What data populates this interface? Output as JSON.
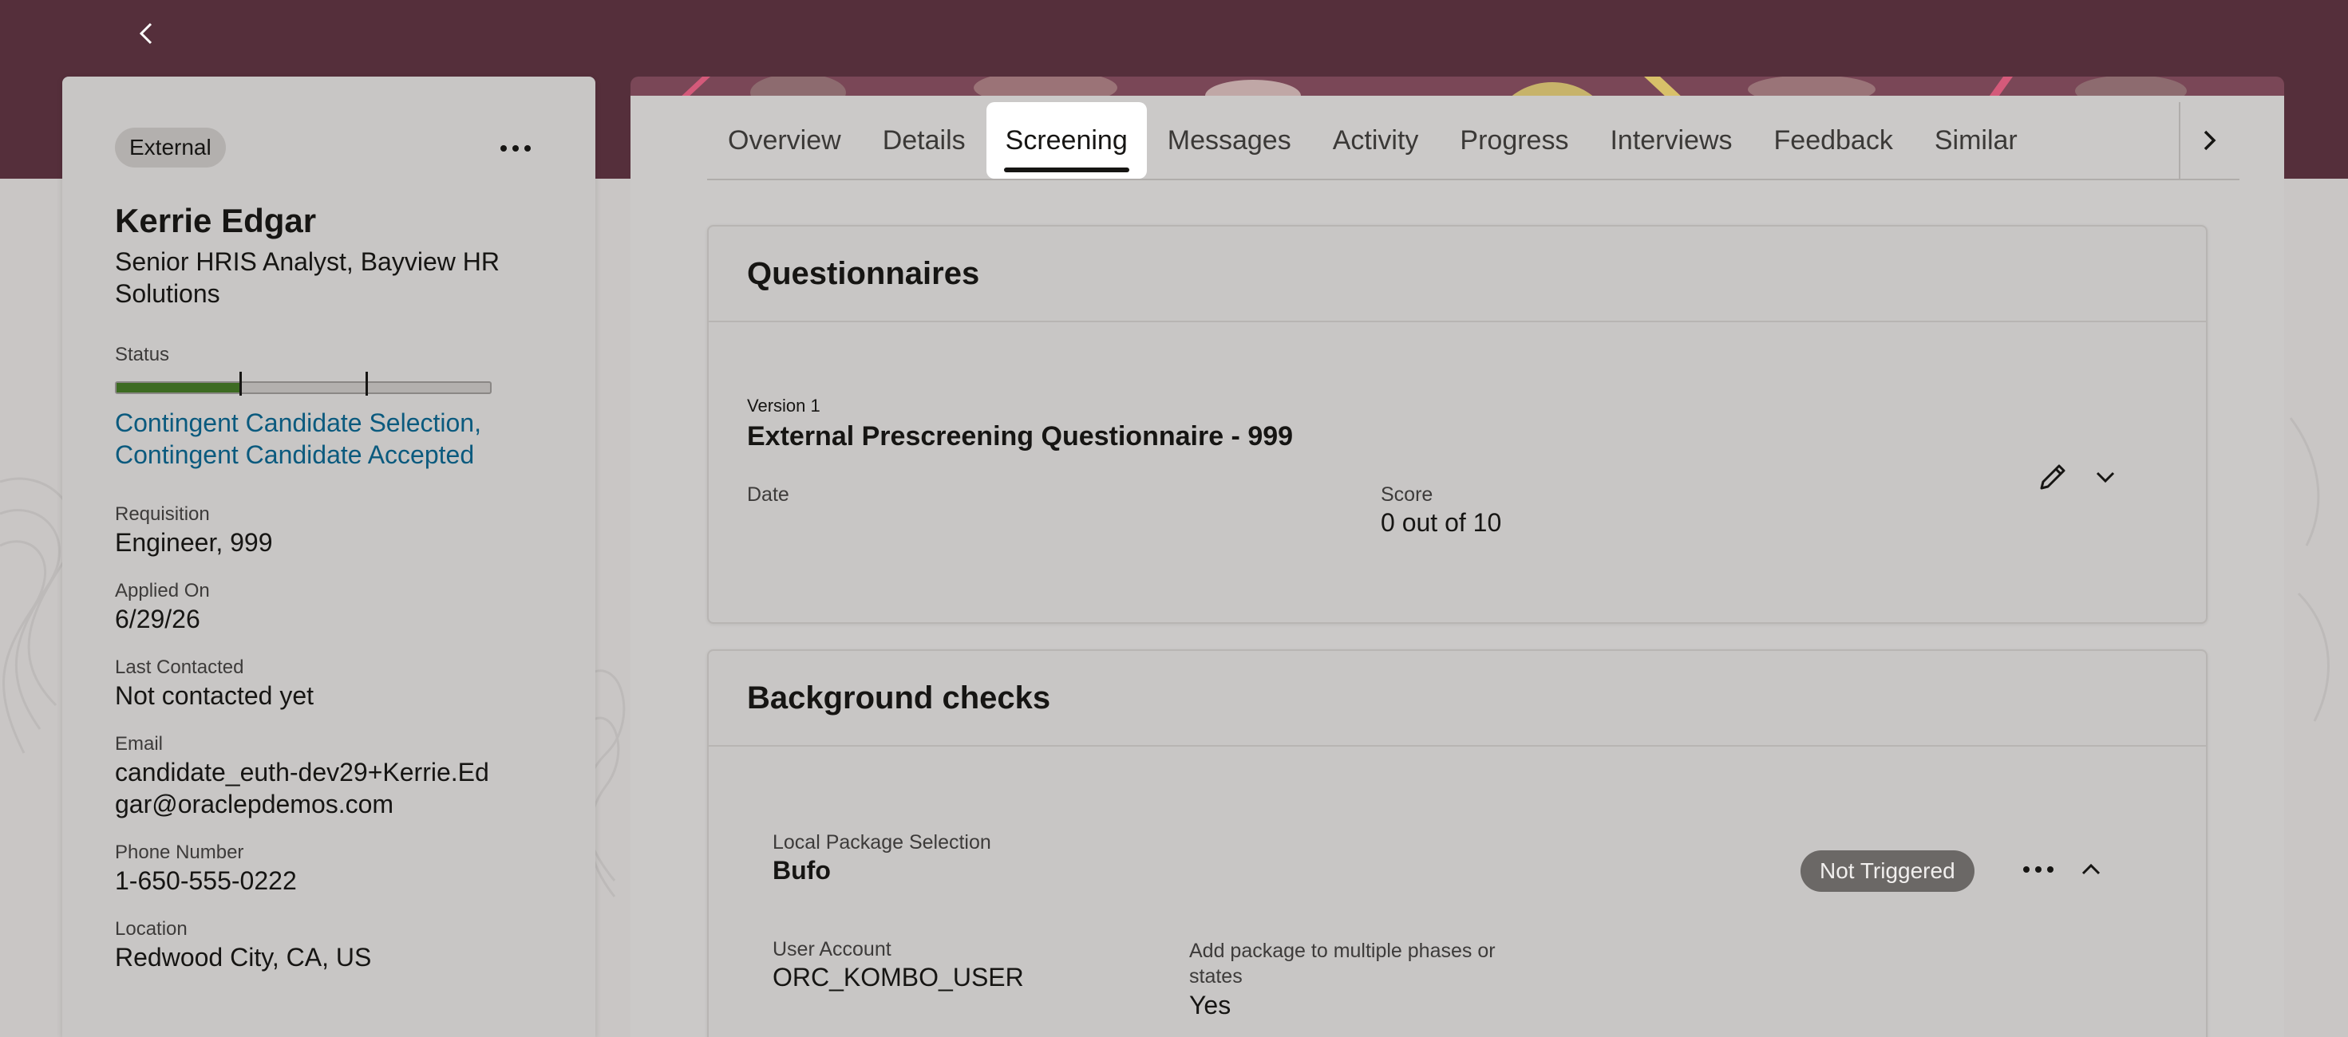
{
  "header": {
    "back_icon": "chevron-left-icon"
  },
  "candidate": {
    "source_badge": "External",
    "name": "Kerrie Edgar",
    "title": "Senior HRIS Analyst, Bayview HR Solutions",
    "status_label": "Status",
    "status_progress": 0.33,
    "status_text": "Contingent Candidate Selection, Contingent Candidate Accepted",
    "requisition_label": "Requisition",
    "requisition": "Engineer, 999",
    "applied_label": "Applied On",
    "applied": "6/29/26",
    "last_contacted_label": "Last Contacted",
    "last_contacted": "Not contacted yet",
    "email_label": "Email",
    "email": "candidate_euth-dev29+Kerrie.Edgar@oraclepdemos.com",
    "phone_label": "Phone Number",
    "phone": "1-650-555-0222",
    "location_label": "Location",
    "location": "Redwood City, CA, US"
  },
  "tabs": [
    {
      "label": "Overview"
    },
    {
      "label": "Details"
    },
    {
      "label": "Screening",
      "active": true
    },
    {
      "label": "Messages"
    },
    {
      "label": "Activity"
    },
    {
      "label": "Progress"
    },
    {
      "label": "Interviews"
    },
    {
      "label": "Feedback"
    },
    {
      "label": "Similar"
    }
  ],
  "questionnaires": {
    "heading": "Questionnaires",
    "version": "Version 1",
    "title": "External Prescreening Questionnaire - 999",
    "date_label": "Date",
    "date": "",
    "score_label": "Score",
    "score": "0 out of 10"
  },
  "background_checks": {
    "heading": "Background checks",
    "package_label": "Local Package Selection",
    "package": "Bufo",
    "status": "Not Triggered",
    "user_account_label": "User Account",
    "user_account": "ORC_KOMBO_USER",
    "multi_phase_label": "Add package to multiple phases or states",
    "multi_phase": "Yes"
  },
  "colors": {
    "banner": "#552f3b",
    "status_fill": "#3d6b22",
    "link": "#0b5a7e"
  }
}
